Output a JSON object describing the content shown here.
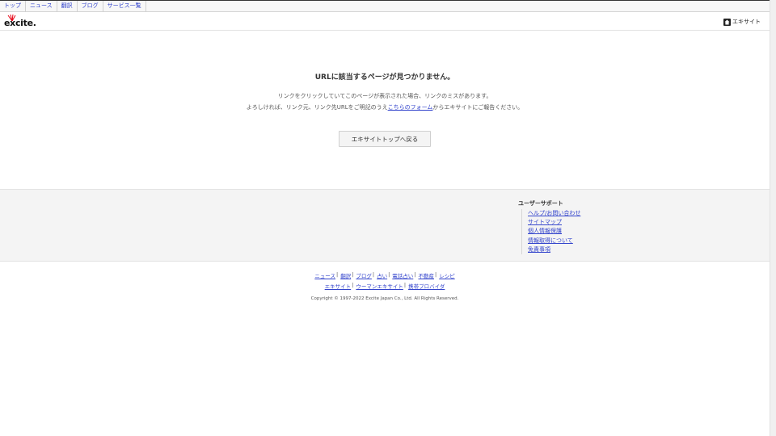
{
  "topnav": {
    "items": [
      "トップ",
      "ニュース",
      "翻訳",
      "ブログ",
      "サービス一覧"
    ]
  },
  "header": {
    "logo_text": "excite.",
    "home_label": "エキサイト",
    "icon": "home-icon",
    "logo_accent": "#e60012"
  },
  "main": {
    "title": "URLに該当するページが見つかりません。",
    "line1": "リンクをクリックしていてこのページが表示された場合、リンクのミスがあります。",
    "line2_before": "よろしければ、リンク元、リンク先URLをご明記のうえ",
    "line2_link": "こちらのフォーム",
    "line2_after": "からエキサイトにご報告ください。",
    "back_button": "エキサイトトップへ戻る"
  },
  "support": {
    "title": "ユーザーサポート",
    "links": [
      "ヘルプ/お問い合わせ",
      "サイトマップ",
      "個人情報保護",
      "情報取得について",
      "免責事項"
    ]
  },
  "footer": {
    "row1": [
      "ニュース",
      "翻訳",
      "ブログ",
      "占い",
      "電話占い",
      "不動産",
      "レシピ"
    ],
    "row2": [
      "エキサイト",
      "ウーマンエキサイト",
      "携帯プロバイダ"
    ],
    "copyright": "Copyright © 1997-2022 Excite Japan Co., Ltd. All Rights Reserved."
  },
  "colors": {
    "link": "#3344cc",
    "background": "#ffffff",
    "support_background": "#f4f4f4"
  }
}
